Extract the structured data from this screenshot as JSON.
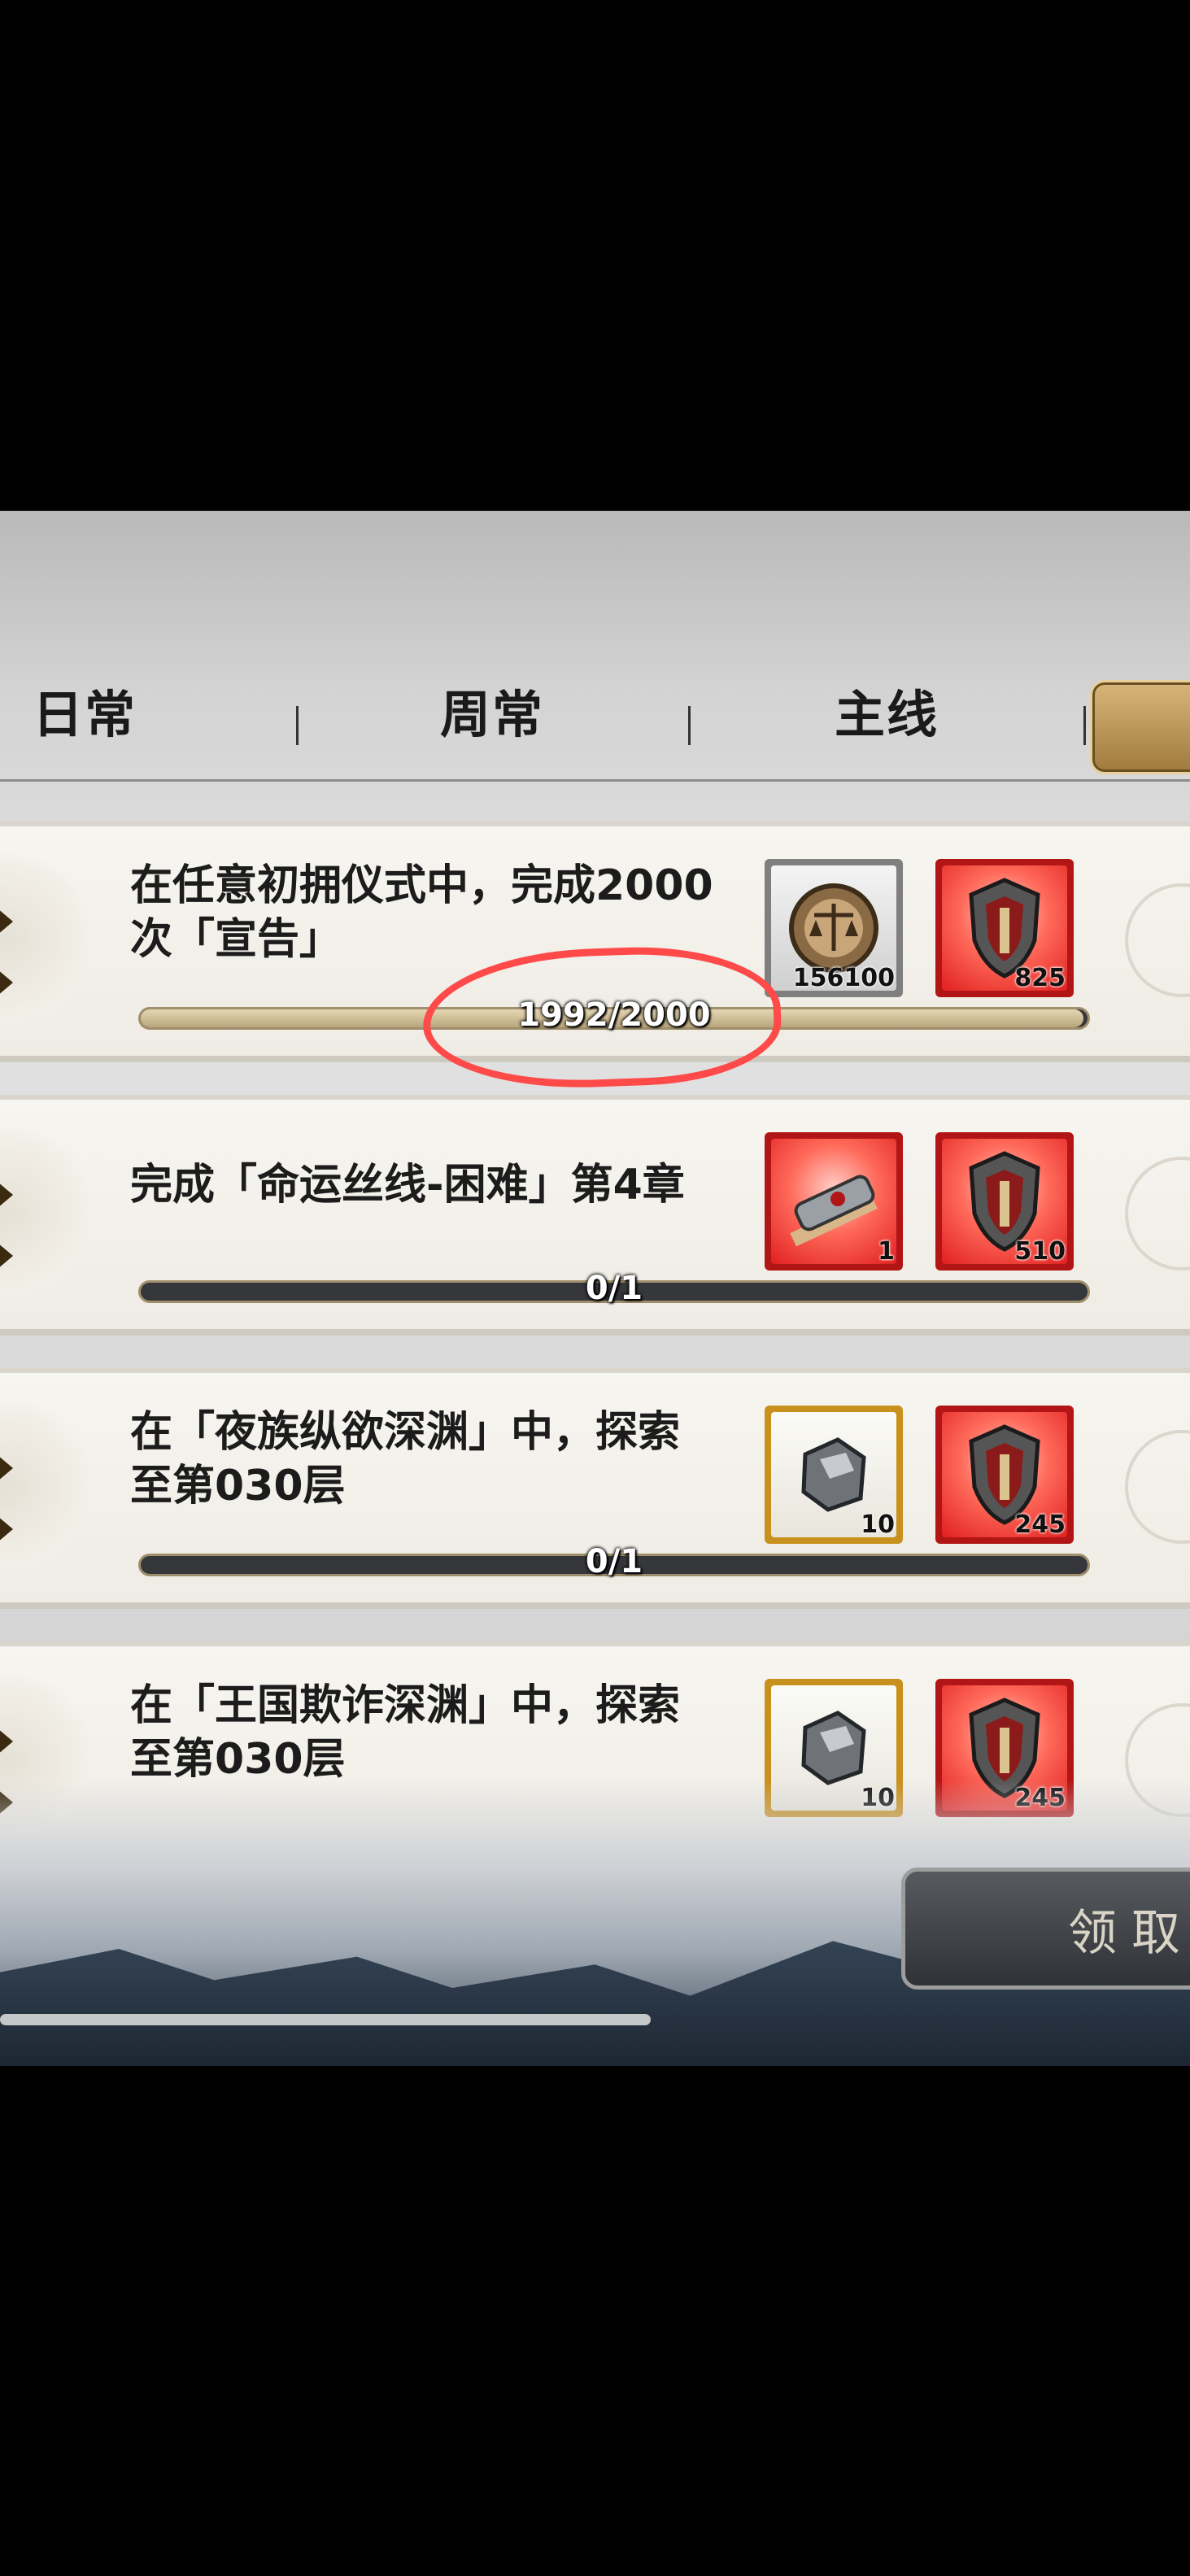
{
  "tabs": [
    {
      "label": "日常"
    },
    {
      "label": "周常"
    },
    {
      "label": "主线"
    }
  ],
  "tasks": [
    {
      "description": "在任意初拥仪式中，完成2000\n次「宣告」",
      "progress_text": "1992/2000",
      "progress_fraction": 0.996,
      "rewards": [
        {
          "icon": "coin-scale-icon",
          "quantity": "156100",
          "rarity": "grey"
        },
        {
          "icon": "shield-icon",
          "quantity": "825",
          "rarity": "red"
        }
      ]
    },
    {
      "description": "完成「命运丝线-困难」第4章",
      "progress_text": "0/1",
      "progress_fraction": 0,
      "rewards": [
        {
          "icon": "scroll-icon",
          "quantity": "1",
          "rarity": "red"
        },
        {
          "icon": "shield-icon",
          "quantity": "510",
          "rarity": "red"
        }
      ]
    },
    {
      "description": "在「夜族纵欲深渊」中，探索\n至第030层",
      "progress_text": "0/1",
      "progress_fraction": 0,
      "rewards": [
        {
          "icon": "ore-icon",
          "quantity": "10",
          "rarity": "gold"
        },
        {
          "icon": "shield-icon",
          "quantity": "245",
          "rarity": "red"
        }
      ]
    },
    {
      "description": "在「王国欺诈深渊」中，探索\n至第030层",
      "rewards": [
        {
          "icon": "ore-icon",
          "quantity": "10",
          "rarity": "gold"
        },
        {
          "icon": "shield-icon",
          "quantity": "245",
          "rarity": "red"
        }
      ]
    }
  ],
  "claim_button": {
    "label": "领取"
  },
  "colors": {
    "annotation": "#ff4a4a",
    "red_rarity": "#b21515",
    "gold_rarity": "#c8901c",
    "grey_rarity": "#7f7f7f"
  }
}
